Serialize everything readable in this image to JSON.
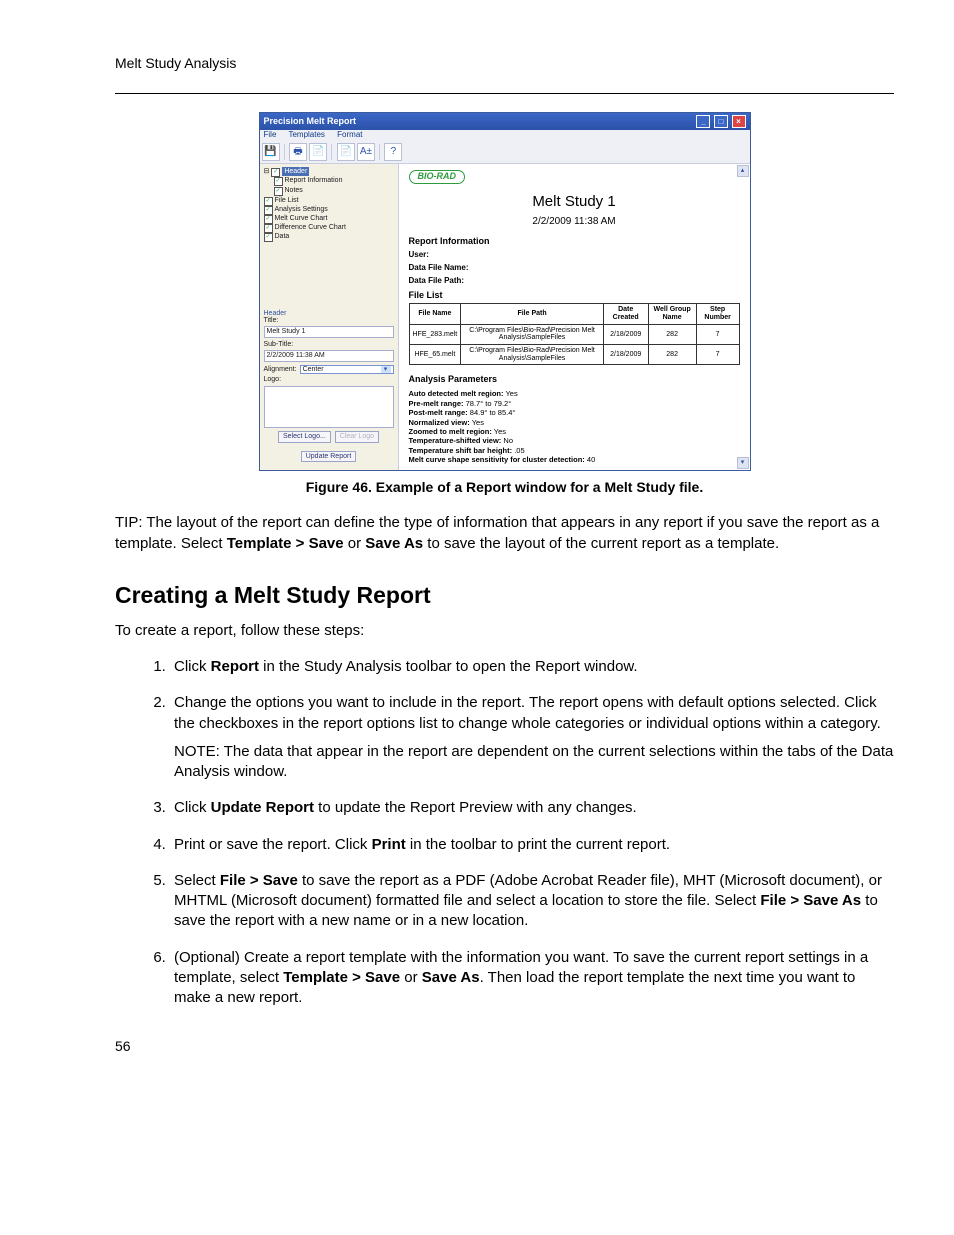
{
  "running_head": "Melt Study Analysis",
  "page_number": "56",
  "window": {
    "title": "Precision Melt Report",
    "menu": {
      "file": "File",
      "templates": "Templates",
      "format": "Format"
    },
    "toolbar": {
      "save": "💾",
      "print": "🖶",
      "page1": "📄",
      "page2": "📄",
      "aplus": "A±",
      "help": "?"
    },
    "tree": {
      "root": "Header",
      "items": [
        "Report Information",
        "Notes",
        "File List",
        "Analysis Settings",
        "Melt Curve Chart",
        "Difference Curve Chart",
        "Data"
      ]
    },
    "form": {
      "header_label": "Header",
      "title_label": "Title:",
      "title_value": "Melt Study 1",
      "subtitle_label": "Sub-Title:",
      "subtitle_value": "2/2/2009 11:38 AM",
      "alignment_label": "Alignment:",
      "alignment_value": "Center",
      "logo_label": "Logo:",
      "select_logo": "Select Logo...",
      "clear_logo": "Clear Logo",
      "update_report": "Update Report"
    },
    "preview": {
      "brand": "BIO-RAD",
      "title": "Melt Study 1",
      "datetime": "2/2/2009 11:38 AM",
      "report_info_h": "Report Information",
      "user": "User:",
      "dfn": "Data File Name:",
      "dfp": "Data File Path:",
      "file_list_h": "File List",
      "headers": {
        "fn": "File Name",
        "fp": "File Path",
        "dc": "Date Created",
        "wgn": "Well Group Name",
        "sn": "Step Number"
      },
      "rows": [
        {
          "fn": "HFE_283.melt",
          "fp": "C:\\Program Files\\Bio-Rad\\Precision Melt Analysis\\SampleFiles",
          "dc": "2/18/2009",
          "wgn": "282",
          "sn": "7"
        },
        {
          "fn": "HFE_65.melt",
          "fp": "C:\\Program Files\\Bio-Rad\\Precision Melt Analysis\\SampleFiles",
          "dc": "2/18/2009",
          "wgn": "282",
          "sn": "7"
        }
      ],
      "ap_h": "Analysis Parameters",
      "ap": {
        "l1a": "Auto detected melt region:",
        "l1b": " Yes",
        "l2a": "Pre-melt range:",
        "l2b": " 78.7° to 79.2°",
        "l3a": "Post-melt range:",
        "l3b": " 84.9° to 85.4°",
        "l4a": "Normalized view:",
        "l4b": " Yes",
        "l5a": "Zoomed to melt region:",
        "l5b": " Yes",
        "l6a": "Temperature-shifted view:",
        "l6b": " No",
        "l7a": "Temperature shift bar height:",
        "l7b": " .05",
        "l8a": "Melt curve shape sensitivity for cluster detection:",
        "l8b": " 40"
      }
    }
  },
  "figure_caption": "Figure 46. Example of a Report window for a Melt Study file.",
  "tip": {
    "pre": "TIP: The layout of the report can define the type of information that appears in any report if you save the report as a template. Select ",
    "b1": "Template > Save",
    "mid": " or ",
    "b2": "Save As",
    "post": " to save the layout of the current report as a template."
  },
  "section_heading": "Creating a Melt Study Report",
  "intro": "To create a report, follow these steps:",
  "steps": {
    "s1": {
      "a": "Click ",
      "b": "Report",
      "c": " in the Study Analysis toolbar to open the Report window."
    },
    "s2": {
      "a": "Change the options you want to include in the report. The report opens with default options selected. Click the checkboxes in the report options list to change whole categories or individual options within a category.",
      "note": "NOTE: The data that appear in the report are dependent on the current selections within the tabs of the Data Analysis window."
    },
    "s3": {
      "a": "Click ",
      "b": "Update Report",
      "c": " to update the Report Preview with any changes."
    },
    "s4": {
      "a": "Print or save the report. Click ",
      "b": "Print",
      "c": " in the toolbar to print the current report."
    },
    "s5": {
      "a": "Select ",
      "b": "File > Save",
      "c": " to save the report as a PDF (Adobe Acrobat Reader file), MHT (Microsoft document), or MHTML (Microsoft document) formatted file and select a location to store the file. Select ",
      "d": "File > Save As",
      "e": " to save the report with a new name or in a new location."
    },
    "s6": {
      "a": "(Optional) Create a report template with the information you want. To save the current report settings in a template, select ",
      "b": "Template > Save",
      "c": " or ",
      "d": "Save As",
      "e": ". Then load the report template the next time you want to make a new report."
    }
  }
}
